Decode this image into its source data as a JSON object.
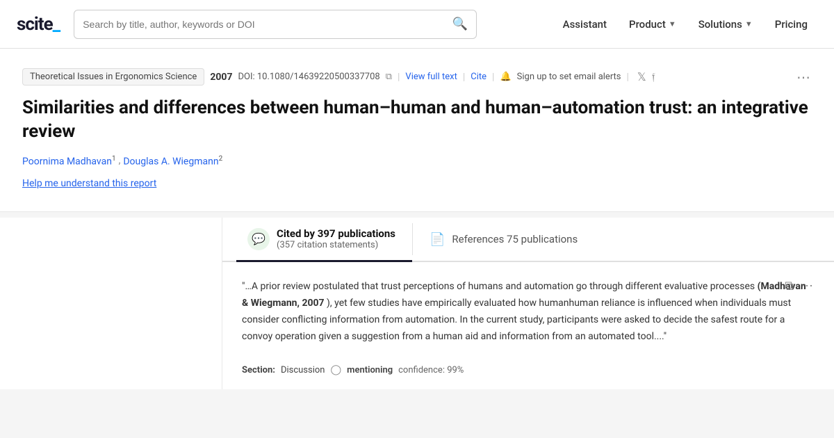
{
  "header": {
    "logo": "scite_",
    "search_placeholder": "Search by title, author, keywords or DOI",
    "nav_items": [
      {
        "label": "Assistant",
        "has_chevron": false
      },
      {
        "label": "Product",
        "has_chevron": true
      },
      {
        "label": "Solutions",
        "has_chevron": true
      },
      {
        "label": "Pricing",
        "has_chevron": false
      }
    ]
  },
  "article": {
    "journal": "Theoretical Issues in Ergonomics Science",
    "year": "2007",
    "doi": "DOI: 10.1080/14639220500337708",
    "view_full_text": "View full text",
    "cite": "Cite",
    "alert_text": "Sign up to set email alerts",
    "title": "Similarities and differences between human–human and human–automation trust: an integrative review",
    "authors": [
      {
        "name": "Poornima Madhavan",
        "superscript": "1"
      },
      {
        "name": "Douglas A. Wiegmann",
        "superscript": "2"
      }
    ],
    "help_link": "Help me understand this report"
  },
  "citations": {
    "tab_active_label": "Cited by 397 publications",
    "tab_active_sub": "(357 citation statements)",
    "tab_refs_label": "References 75 publications",
    "quote_text_before": "\"…A prior review postulated that trust perceptions of humans and automation go through different evaluative processes ",
    "quote_bold": "(Madhavan & Wiegmann, 2007",
    "quote_text_after": " ), yet few studies have empirically evaluated how humanhuman reliance is influenced when individuals must consider conflicting information from automation. In the current study, participants were asked to decide the safest route for a convoy operation given a suggestion from a human aid and information from an automated tool....\"",
    "section_label": "Section:",
    "section_value": "Discussion",
    "mentioning_label": "mentioning",
    "confidence_label": "confidence: 99%"
  }
}
